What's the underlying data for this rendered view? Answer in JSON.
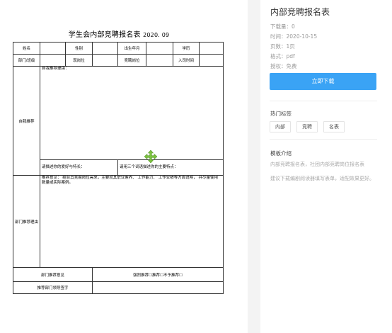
{
  "document": {
    "title": "学生会内部竞聘报名表",
    "date": "2020. 09",
    "rows": {
      "r1": [
        "姓名",
        "",
        "性别",
        "",
        "出生年月",
        "",
        "学历",
        ""
      ],
      "r2": [
        "部门/班级",
        "",
        "现岗位",
        "",
        "竞聘岗位",
        "",
        "入司时间",
        ""
      ],
      "self_label": "自我推荐",
      "self_reason": "自我推荐理由：",
      "hobby_prompt": "请描述你的爱好与特长：",
      "traits_prompt": "请用三个词语描述你的主要特点：",
      "dept_label": "部门推荐理由",
      "dept_text": "推荐意见： 结合其竞聘岗位需求，主要就其职业素养、 工作能力、 工作业绩等方面说明， 并尽量使用数量或实际案例。",
      "opinion_label": "部门推荐意见",
      "opinion_value": "强烈推荐☐推荐☐不予推荐☐",
      "signature_label": "推荐部门领导签字"
    }
  },
  "sidebar": {
    "title": "内部竞聘报名表",
    "downloads": "下载量：0",
    "time": "时间：2020-10-15",
    "pages": "页数：1页",
    "format": "格式：pdf",
    "license": "授权：免费",
    "download_button": "立即下载",
    "hot_tags_title": "热门标签",
    "tags": [
      "内部",
      "竞聘",
      "名表"
    ],
    "template_intro_title": "模板介绍",
    "intro_line1": "内部竞聘报名表，社团内部竞聘岗位报名表",
    "intro_line2": "建议下载编剧阅读器填写表单，适配效果更好。"
  },
  "colors": {
    "accent": "#3aa3f5",
    "cursor": "#7cc23f"
  },
  "icons": {
    "cursor": "move-cursor-icon"
  }
}
